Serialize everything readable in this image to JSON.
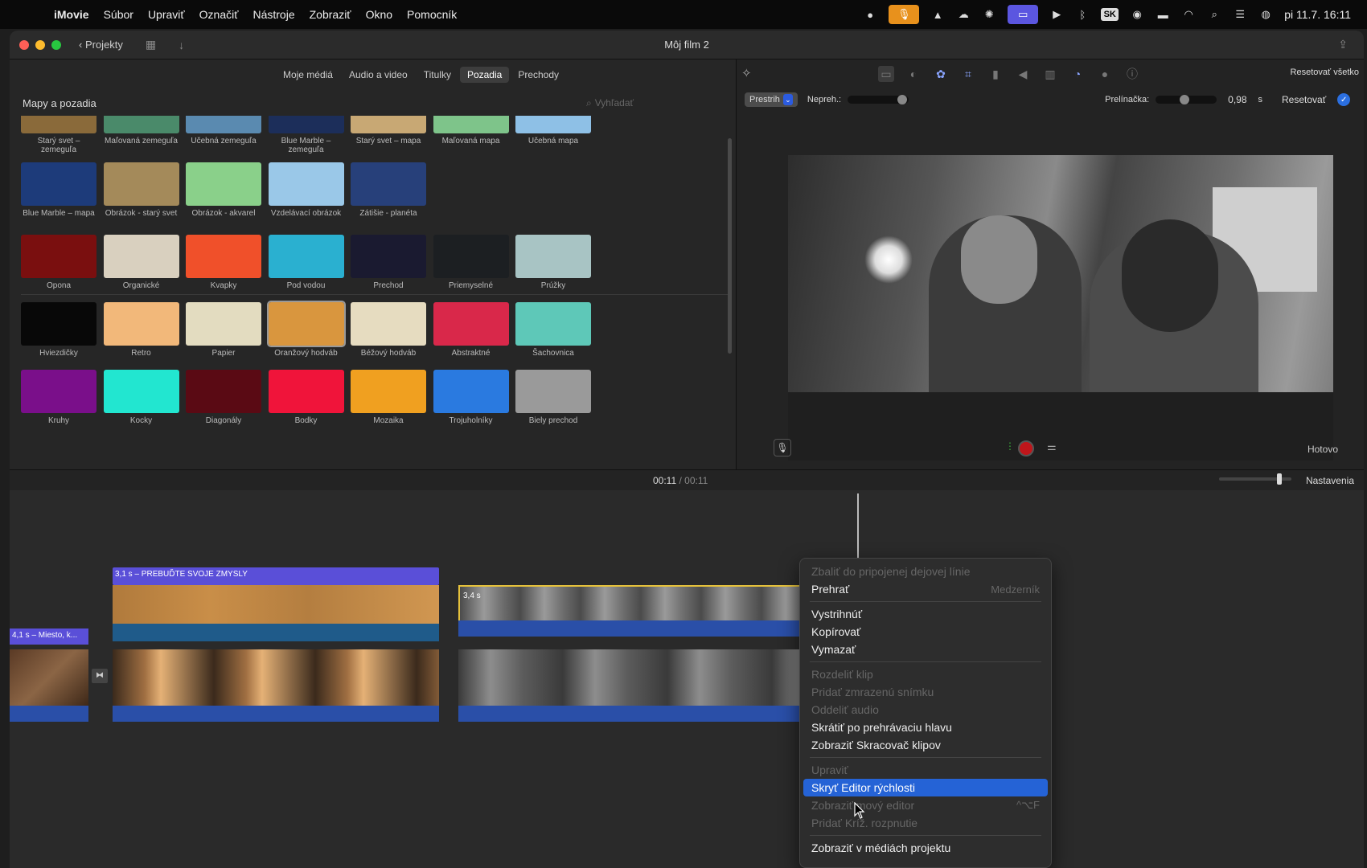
{
  "menubar": {
    "app": "iMovie",
    "items": [
      "Súbor",
      "Upraviť",
      "Označiť",
      "Nástroje",
      "Zobraziť",
      "Okno",
      "Pomocník"
    ],
    "kbd": "SK",
    "datetime": "pi 11.7.  16:11"
  },
  "window": {
    "title": "Môj film 2",
    "back_label": "Projekty"
  },
  "browser": {
    "tabs": [
      "Moje médiá",
      "Audio a video",
      "Titulky",
      "Pozadia",
      "Prechody"
    ],
    "active_tab": "Pozadia",
    "heading": "Mapy a pozadia",
    "search_placeholder": "Vyhľadať",
    "items": [
      {
        "label": "Starý svet – zemeguľa",
        "color": "#8a6a3a"
      },
      {
        "label": "Maľovaná zemeguľa",
        "color": "#4a8a6a"
      },
      {
        "label": "Učebná zemeguľa",
        "color": "#5a8ab0"
      },
      {
        "label": "Blue Marble – zemeguľa",
        "color": "#1c2e5a"
      },
      {
        "label": "Starý svet – mapa",
        "color": "#c8a874"
      },
      {
        "label": "Maľovaná mapa",
        "color": "#7ec48a"
      },
      {
        "label": "Učebná mapa",
        "color": "#8ec0e6"
      },
      {
        "label": "Blue Marble – mapa",
        "color": "#1d3b7a"
      },
      {
        "label": "Obrázok - starý svet",
        "color": "#a48a5a"
      },
      {
        "label": "Obrázok - akvarel",
        "color": "#8ad08a"
      },
      {
        "label": "Vzdelávací obrázok",
        "color": "#9ac8e8"
      },
      {
        "label": "Zátišie - planéta",
        "color": "#27407a"
      },
      {
        "label": "Opona",
        "color": "#7a0f0f"
      },
      {
        "label": "Organické",
        "color": "#d9d0bf"
      },
      {
        "label": "Kvapky",
        "color": "#f0502a"
      },
      {
        "label": "Pod vodou",
        "color": "#2ab0d0"
      },
      {
        "label": "Prechod",
        "color": "#1a1a30"
      },
      {
        "label": "Priemyselné",
        "color": "#1c1f22"
      },
      {
        "label": "Prúžky",
        "color": "#a8c4c4"
      },
      {
        "label": "Hviezdičky",
        "color": "#080808"
      },
      {
        "label": "Retro",
        "color": "#f2b87a"
      },
      {
        "label": "Papier",
        "color": "#e3dcc0"
      },
      {
        "label": "Oranžový hodváb",
        "color": "#d9963e"
      },
      {
        "label": "Béžový hodváb",
        "color": "#e6dcc0"
      },
      {
        "label": "Abstraktné",
        "color": "#d9284a"
      },
      {
        "label": "Šachovnica",
        "color": "#5ec8b8"
      },
      {
        "label": "Kruhy",
        "color": "#7a0f8a"
      },
      {
        "label": "Kocky",
        "color": "#22e6d0"
      },
      {
        "label": "Diagonály",
        "color": "#5a0a14"
      },
      {
        "label": "Bodky",
        "color": "#f0143a"
      },
      {
        "label": "Mozaika",
        "color": "#f0a020"
      },
      {
        "label": "Trojuholníky",
        "color": "#2a7ae0"
      },
      {
        "label": "Biely prechod",
        "color": "#9a9a9a"
      }
    ]
  },
  "viewer": {
    "reset_all": "Resetovať všetko",
    "mode": "Prestrih",
    "opacity_label": "Nepreh.:",
    "crossfade_label": "Prelínačka:",
    "crossfade_value": "0,98",
    "crossfade_unit": "s",
    "reset": "Resetovať",
    "done": "Hotovo"
  },
  "timebar": {
    "current": "00:11",
    "separator": "/",
    "total": "00:11",
    "settings": "Nastavenia"
  },
  "timeline": {
    "title_clip": "3,1 s – PREBUĎTE SVOJE ZMYSLY",
    "small_title": "4,1 s – Miesto, k...",
    "selected_clip": "3,4 s"
  },
  "context_menu": {
    "items": [
      {
        "label": "Zbaliť do pripojenej dejovej línie",
        "disabled": true
      },
      {
        "label": "Prehrať",
        "shortcut": "Medzerník"
      },
      {
        "divider": true
      },
      {
        "label": "Vystrihnúť"
      },
      {
        "label": "Kopírovať"
      },
      {
        "label": "Vymazať"
      },
      {
        "divider": true
      },
      {
        "label": "Rozdeliť klip",
        "disabled": true
      },
      {
        "label": "Pridať zmrazenú snímku",
        "disabled": true
      },
      {
        "label": "Oddeliť audio",
        "disabled": true
      },
      {
        "label": "Skrátiť po prehrávaciu hlavu"
      },
      {
        "label": "Zobraziť Skracovač klipov"
      },
      {
        "divider": true
      },
      {
        "label": "Upraviť",
        "disabled": true
      },
      {
        "label": "Skryť Editor rýchlosti",
        "highlighted": true
      },
      {
        "label": "Zobraziť  mový editor",
        "disabled": true,
        "shortcut": "^⌥F"
      },
      {
        "label": "Pridať Kríž. rozpnutie",
        "disabled": true
      },
      {
        "divider": true
      },
      {
        "label": "Zobraziť v médiách projektu"
      }
    ]
  }
}
